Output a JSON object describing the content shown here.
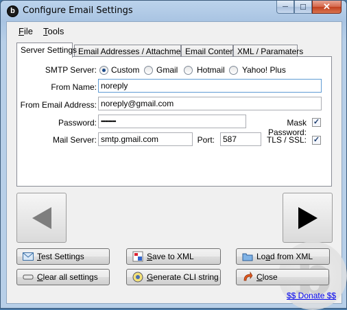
{
  "window": {
    "title": "Configure Email Settings",
    "app_icon_letter": "b"
  },
  "caption_buttons": {
    "minimize": "─",
    "maximize": "☐",
    "close": "✕"
  },
  "menu": [
    {
      "label_underlined": "F",
      "label_rest": "ile"
    },
    {
      "label_underlined": "T",
      "label_rest": "ools"
    }
  ],
  "tabs": [
    "Server Settings",
    "Email Addresses / Attachment",
    "Email Content",
    "XML / Paramaters"
  ],
  "server_settings": {
    "smtp_label": "SMTP Server:",
    "smtp_options": [
      "Custom",
      "Gmail",
      "Hotmail",
      "Yahoo! Plus"
    ],
    "smtp_selected": "Custom",
    "from_name_label": "From Name:",
    "from_name_value": "noreply",
    "from_email_label": "From Email Address:",
    "from_email_value": "noreply@gmail.com",
    "password_label": "Password:",
    "password_value": "••••••••••",
    "mask_password_label": "Mask Password:",
    "mask_password_checked": true,
    "mail_server_label": "Mail Server:",
    "mail_server_value": "smtp.gmail.com",
    "port_label": "Port:",
    "port_value": "587",
    "tls_label": "TLS / SSL:",
    "tls_checked": true
  },
  "buttons": {
    "test_underlined": "T",
    "test_rest": "est Settings",
    "clear_pre": "",
    "clear_underlined": "C",
    "clear_rest": "lear all settings",
    "save_underlined": "S",
    "save_rest": "ave to XML",
    "generate_underlined": "G",
    "generate_rest": "enerate CLI string",
    "load_pre": "Lo",
    "load_underlined": "a",
    "load_rest": "d from XML",
    "close_underlined": "C",
    "close_rest": "lose"
  },
  "donate_link": "$$ Donate $$",
  "check_mark": "✓",
  "icons": {
    "test": "envelope-icon",
    "clear": "eraser-icon",
    "save": "save-xml-icon",
    "generate": "cli-icon",
    "load": "folder-open-icon",
    "close": "close-arrow-icon",
    "back": "arrow-left-icon",
    "forward": "arrow-right-icon"
  }
}
